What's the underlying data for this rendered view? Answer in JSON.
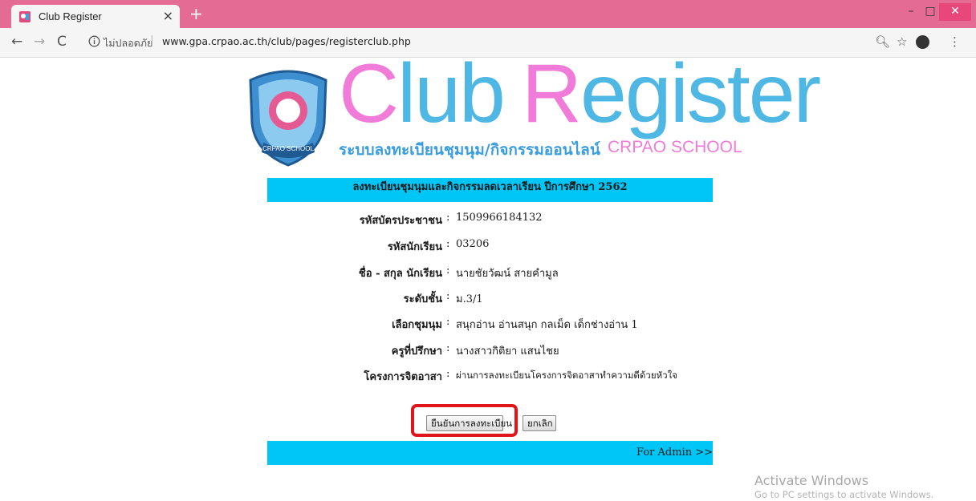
{
  "browser": {
    "tab_title": "Club Register",
    "tab_close": "×",
    "new_tab": "+",
    "security_label": "ไม่ปลอดภัย",
    "url": "www.gpa.crpao.ac.th/club/pages/registerclub.php",
    "window_controls": {
      "minimize": "–",
      "maximize": "□",
      "close": "✕"
    },
    "icons": {
      "back": "←",
      "forward": "→",
      "reload": "C",
      "zoom": "🔍︎",
      "star": "☆",
      "menu": "⋮"
    },
    "accent_color": "#e46b93"
  },
  "logo": {
    "title_c": "C",
    "title_lub": "lub",
    "title_r": "R",
    "title_egister": "egister",
    "subtitle": "ระบบลงทะเบียนชุมนุม/กิจกรรมออนไลน์",
    "school": "CRPAO SCHOOL",
    "crest_text": "CRPAO SCHOOL",
    "colors": {
      "pink": "#f07bd8",
      "blue": "#4fb7e4"
    }
  },
  "form": {
    "header": "ลงทะเบียนชุมนุมและกิจกรรมลดเวลาเรียน ปีการศึกษา 2562",
    "colon": ":",
    "rows": [
      {
        "label": "รหัสบัตรประชาชน",
        "value": "1509966184132"
      },
      {
        "label": "รหัสนักเรียน",
        "value": "03206"
      },
      {
        "label": "ชื่อ - สกุล นักเรียน",
        "value": "นายชัยวัฒน์   สายคำมูล"
      },
      {
        "label": "ระดับชั้น",
        "value": "ม.3/1"
      },
      {
        "label": "เลือกชุมนุม",
        "value": "สนุกอ่าน อ่านสนุก กลเม็ด เด็กช่างอ่าน 1"
      },
      {
        "label": "ครูที่ปรึกษา",
        "value": "นางสาวกิติยา แสนไชย"
      },
      {
        "label": "โครงการจิตอาสา",
        "value": "ผ่านการลงทะเบียนโครงการจิตอาสาทำความดีด้วยหัวใจ"
      }
    ],
    "confirm_button": "ยืนยันการลงทะเบียน",
    "cancel_button": "ยกเลิก",
    "admin_link": "For Admin >>",
    "bar_color": "#00c5f7"
  },
  "watermark": {
    "title": "Activate Windows",
    "subtitle": "Go to PC settings to activate Windows."
  }
}
